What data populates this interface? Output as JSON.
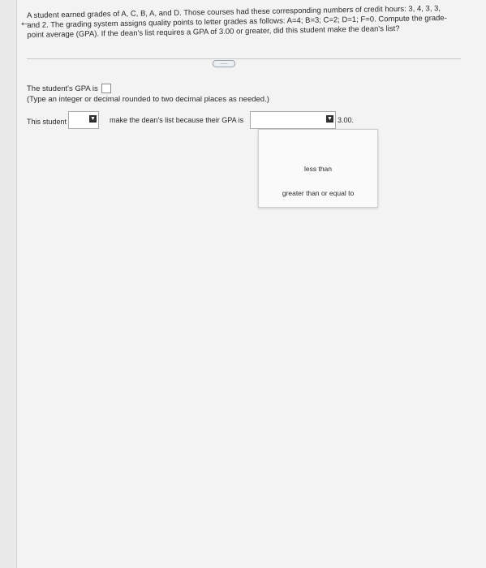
{
  "nav": {
    "back_icon": "left-arrow-icon",
    "back_glyph": "←"
  },
  "question": {
    "text": "A student earned grades of A, C, B, A, and D. Those courses had these corresponding numbers of credit hours: 3, 4, 3, 3, and 2. The grading system assigns quality points to letter grades as follows: A=4; B=3; C=2; D=1; F=0. Compute the grade-point average (GPA). If the dean's list requires a GPA of 3.00 or greater, did this student make the dean's list?"
  },
  "more_button": {
    "label": "....."
  },
  "gpa": {
    "label": "The student's GPA is",
    "value": ""
  },
  "hint": {
    "text": "(Type an integer or decimal rounded to two decimal places as needed.)"
  },
  "deans": {
    "prefix": "This student",
    "middle": "make the dean's list because their GPA is",
    "threshold": "3.00.",
    "dropdown1_value": "",
    "dropdown2_value": ""
  },
  "menu": {
    "options": [
      "less than",
      "greater than or equal to"
    ]
  }
}
